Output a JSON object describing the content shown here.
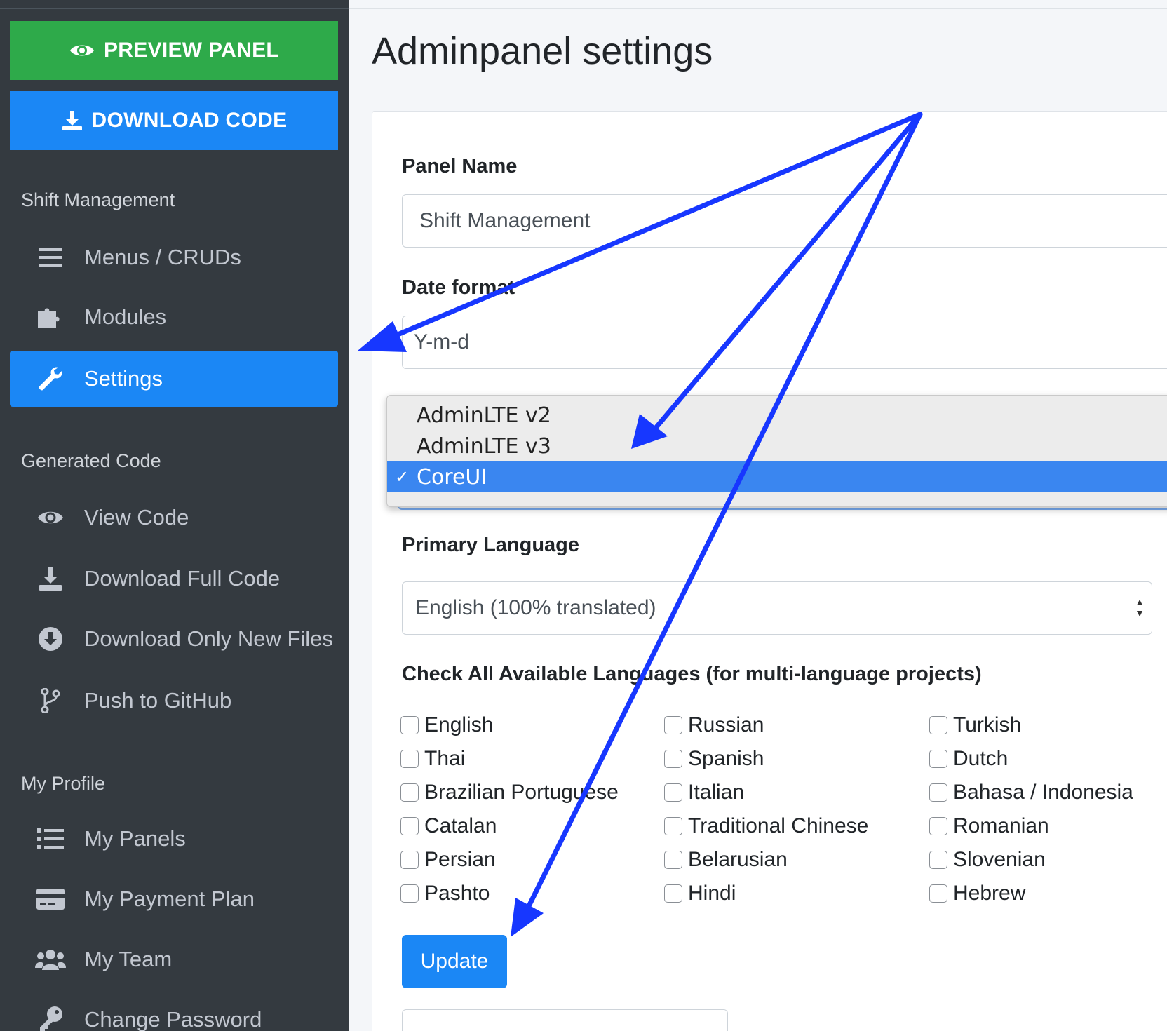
{
  "sidebar": {
    "preview_label": "PREVIEW PANEL",
    "download_label": "DOWNLOAD CODE",
    "section_project": "Shift Management",
    "items_project": [
      {
        "label": "Menus / CRUDs",
        "icon": "bars-icon"
      },
      {
        "label": "Modules",
        "icon": "puzzle-icon"
      },
      {
        "label": "Settings",
        "icon": "wrench-icon",
        "active": true
      }
    ],
    "section_code": "Generated Code",
    "items_code": [
      {
        "label": "View Code",
        "icon": "eye-icon"
      },
      {
        "label": "Download Full Code",
        "icon": "download-icon"
      },
      {
        "label": "Download Only New Files",
        "icon": "arrow-circle-down-icon"
      },
      {
        "label": "Push to GitHub",
        "icon": "code-branch-icon"
      }
    ],
    "section_profile": "My Profile",
    "items_profile": [
      {
        "label": "My Panels",
        "icon": "list-icon"
      },
      {
        "label": "My Payment Plan",
        "icon": "credit-card-icon"
      },
      {
        "label": "My Team",
        "icon": "users-icon"
      },
      {
        "label": "Change Password",
        "icon": "key-icon"
      }
    ]
  },
  "main": {
    "title": "Adminpanel settings",
    "panel_name_label": "Panel Name",
    "panel_name_value": "Shift Management",
    "date_format_label": "Date format",
    "date_format_value": "Y-m-d",
    "template_dropdown": {
      "options": [
        "AdminLTE v2",
        "AdminLTE v3",
        "CoreUI"
      ],
      "selected": "CoreUI",
      "check_mark": "✓"
    },
    "primary_language_label": "Primary Language",
    "primary_language_value": "English (100% translated)",
    "languages_label": "Check All Available Languages (for multi-language projects)",
    "languages": {
      "col1": [
        "English",
        "Thai",
        "Brazilian Portuguese",
        "Catalan",
        "Persian",
        "Pashto"
      ],
      "col2": [
        "Russian",
        "Spanish",
        "Italian",
        "Traditional Chinese",
        "Belarusian",
        "Hindi"
      ],
      "col3": [
        "Turkish",
        "Dutch",
        "Bahasa / Indonesia",
        "Romanian",
        "Slovenian",
        "Hebrew"
      ]
    },
    "update_label": "Update"
  },
  "colors": {
    "sidebar_bg": "#343a40",
    "preview_green": "#2eaa4a",
    "primary_blue": "#1b87f5",
    "annotation_arrow": "#1737ff"
  }
}
